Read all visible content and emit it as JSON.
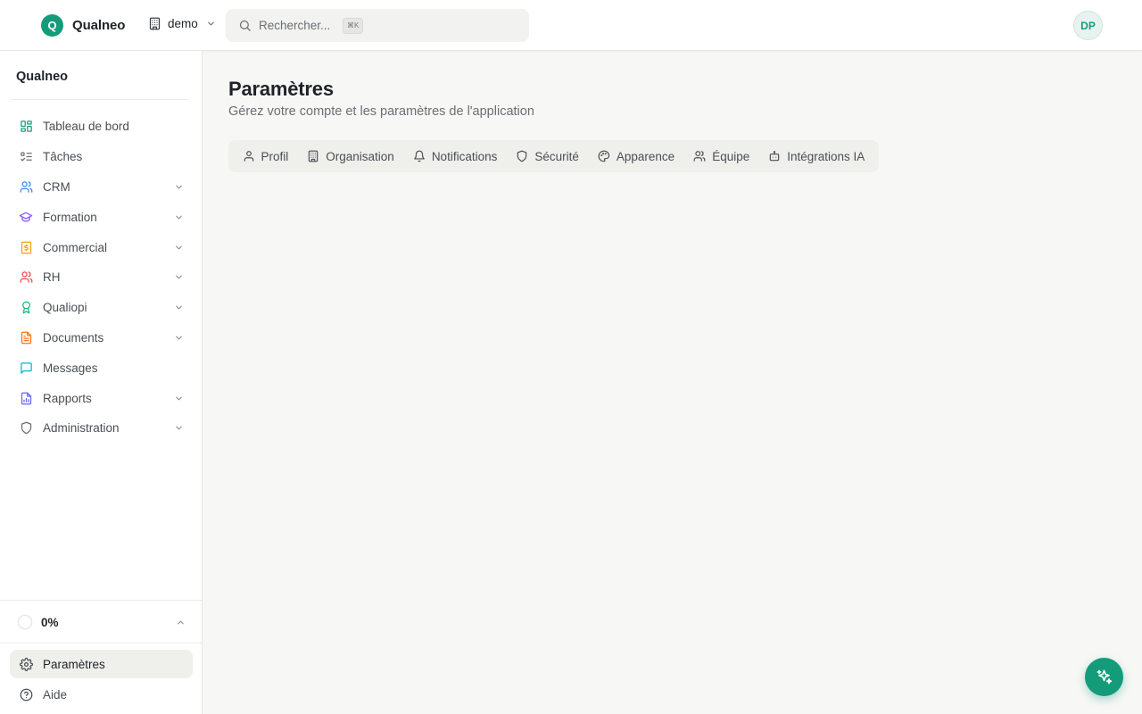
{
  "topbar": {
    "brand_initial": "Q",
    "brand_name": "Qualneo",
    "workspace": "demo",
    "search_placeholder": "Rechercher...",
    "search_shortcut": "⌘K",
    "avatar_initials": "DP"
  },
  "sidebar": {
    "title": "Qualneo",
    "items": [
      {
        "label": "Tableau de bord",
        "icon": "dashboard-icon",
        "color": "#149c7a",
        "expandable": false
      },
      {
        "label": "Tâches",
        "icon": "tasks-list-icon",
        "color": "#6b6f74",
        "expandable": false
      },
      {
        "label": "CRM",
        "icon": "users-icon",
        "color": "#3b82f6",
        "expandable": true
      },
      {
        "label": "Formation",
        "icon": "graduation-cap-icon",
        "color": "#8b5cf6",
        "expandable": true
      },
      {
        "label": "Commercial",
        "icon": "dollar-document-icon",
        "color": "#f59e0b",
        "expandable": true
      },
      {
        "label": "RH",
        "icon": "people-icon",
        "color": "#ef4444",
        "expandable": true
      },
      {
        "label": "Qualiopi",
        "icon": "award-icon",
        "color": "#10b981",
        "expandable": true
      },
      {
        "label": "Documents",
        "icon": "file-text-icon",
        "color": "#f97316",
        "expandable": true
      },
      {
        "label": "Messages",
        "icon": "message-square-icon",
        "color": "#06b6d4",
        "expandable": false
      },
      {
        "label": "Rapports",
        "icon": "report-chart-icon",
        "color": "#6366f1",
        "expandable": true
      },
      {
        "label": "Administration",
        "icon": "shield-icon",
        "color": "#6b6f74",
        "expandable": true
      }
    ],
    "progress": {
      "label": "0%",
      "value": 0
    },
    "bottom_items": [
      {
        "label": "Paramètres",
        "icon": "gear-icon",
        "active": true
      },
      {
        "label": "Aide",
        "icon": "help-circle-icon",
        "active": false
      }
    ]
  },
  "main": {
    "title": "Paramètres",
    "subtitle": "Gérez votre compte et les paramètres de l'application",
    "tabs": [
      {
        "label": "Profil",
        "icon": "user-icon"
      },
      {
        "label": "Organisation",
        "icon": "building-icon"
      },
      {
        "label": "Notifications",
        "icon": "bell-icon"
      },
      {
        "label": "Sécurité",
        "icon": "shield-icon"
      },
      {
        "label": "Apparence",
        "icon": "palette-icon"
      },
      {
        "label": "Équipe",
        "icon": "users-icon"
      },
      {
        "label": "Intégrations IA",
        "icon": "bot-icon"
      }
    ]
  },
  "fab": {
    "icon": "sparkles-icon",
    "color": "#149c7a"
  }
}
